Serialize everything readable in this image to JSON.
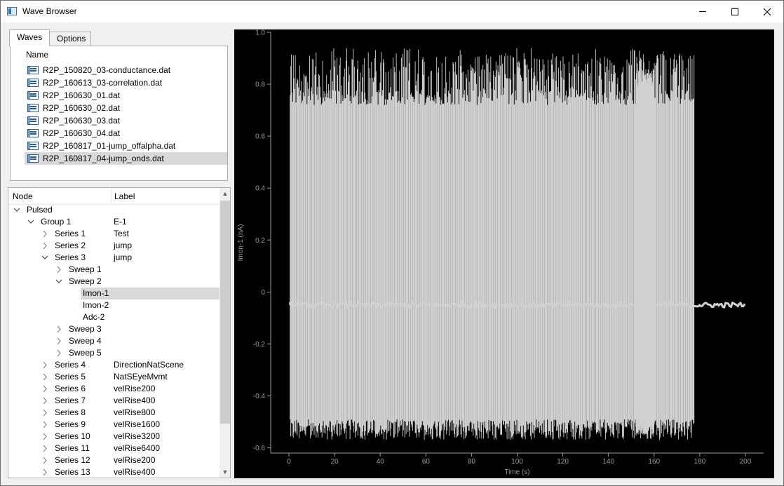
{
  "window": {
    "title": "Wave Browser"
  },
  "tabs": [
    {
      "label": "Waves"
    },
    {
      "label": "Options"
    }
  ],
  "waves": {
    "header": "Name",
    "files": [
      "R2P_150820_03-conductance.dat",
      "R2P_160613_03-correlation.dat",
      "R2P_160630_01.dat",
      "R2P_160630_02.dat",
      "R2P_160630_03.dat",
      "R2P_160630_04.dat",
      "R2P_160817_01-jump_offalpha.dat",
      "R2P_160817_04-jump_onds.dat"
    ],
    "selected_index": 7
  },
  "tree": {
    "columns": {
      "node": "Node",
      "label": "Label"
    },
    "rows": [
      {
        "node": "Pulsed",
        "label": "",
        "depth": 0,
        "expand": "open"
      },
      {
        "node": "Group 1",
        "label": "E-1",
        "depth": 1,
        "expand": "open"
      },
      {
        "node": "Series 1",
        "label": "Test",
        "depth": 2,
        "expand": "closed"
      },
      {
        "node": "Series 2",
        "label": "jump",
        "depth": 2,
        "expand": "closed"
      },
      {
        "node": "Series 3",
        "label": "jump",
        "depth": 2,
        "expand": "open"
      },
      {
        "node": "Sweep 1",
        "label": "",
        "depth": 3,
        "expand": "closed"
      },
      {
        "node": "Sweep 2",
        "label": "",
        "depth": 3,
        "expand": "open"
      },
      {
        "node": "Imon-1",
        "label": "",
        "depth": 4,
        "expand": "none",
        "selected": true
      },
      {
        "node": "Imon-2",
        "label": "",
        "depth": 4,
        "expand": "none"
      },
      {
        "node": "Adc-2",
        "label": "",
        "depth": 4,
        "expand": "none"
      },
      {
        "node": "Sweep 3",
        "label": "",
        "depth": 3,
        "expand": "closed"
      },
      {
        "node": "Sweep 4",
        "label": "",
        "depth": 3,
        "expand": "closed"
      },
      {
        "node": "Sweep 5",
        "label": "",
        "depth": 3,
        "expand": "closed"
      },
      {
        "node": "Series 4",
        "label": "DirectionNatScene",
        "depth": 2,
        "expand": "closed"
      },
      {
        "node": "Series 5",
        "label": "NatSEyeMvmt",
        "depth": 2,
        "expand": "closed"
      },
      {
        "node": "Series 6",
        "label": "velRise200",
        "depth": 2,
        "expand": "closed"
      },
      {
        "node": "Series 7",
        "label": "velRise400",
        "depth": 2,
        "expand": "closed"
      },
      {
        "node": "Series 8",
        "label": "velRise800",
        "depth": 2,
        "expand": "closed"
      },
      {
        "node": "Series 9",
        "label": "velRise1600",
        "depth": 2,
        "expand": "closed"
      },
      {
        "node": "Series 10",
        "label": "velRise3200",
        "depth": 2,
        "expand": "closed"
      },
      {
        "node": "Series 11",
        "label": "velRise6400",
        "depth": 2,
        "expand": "closed"
      },
      {
        "node": "Series 12",
        "label": "velRise200",
        "depth": 2,
        "expand": "closed"
      },
      {
        "node": "Series 13",
        "label": "velRise400",
        "depth": 2,
        "expand": "closed"
      }
    ]
  },
  "colors": {
    "plot_background": "#000000",
    "trace": "#d0d0d0",
    "axis": "#9a9a9a",
    "selection": "#d9d9d9"
  },
  "icons": {
    "minimize": "minimize-icon",
    "maximize": "maximize-icon",
    "close": "close-icon",
    "file": "wave-file-icon",
    "expand_open": "chevron-down-icon",
    "expand_closed": "chevron-right-icon"
  },
  "chart_data": {
    "type": "line",
    "xlabel": "Time (s)",
    "ylabel": "Imon-1 (nA)",
    "xlim": [
      -8,
      208
    ],
    "ylim": [
      -0.62,
      1.0
    ],
    "xticks": [
      0,
      20,
      40,
      60,
      80,
      100,
      120,
      140,
      160,
      180,
      200
    ],
    "yticks": [
      -0.6,
      -0.4,
      -0.2,
      0,
      0.2,
      0.4,
      0.6,
      0.8,
      1.0
    ],
    "ytick_labels": [
      "-0.6",
      "-0.4",
      "-0.2",
      "0",
      "0.2",
      "0.4",
      "0.6",
      "0.8",
      "1.0"
    ],
    "baseline": -0.05,
    "spike_region": [
      0.5,
      177.5
    ],
    "flat_region": [
      178,
      200
    ],
    "spike_peak_range": [
      0.72,
      0.94
    ],
    "spike_trough_range": [
      -0.57,
      -0.49
    ],
    "grid": false,
    "legend": false
  }
}
